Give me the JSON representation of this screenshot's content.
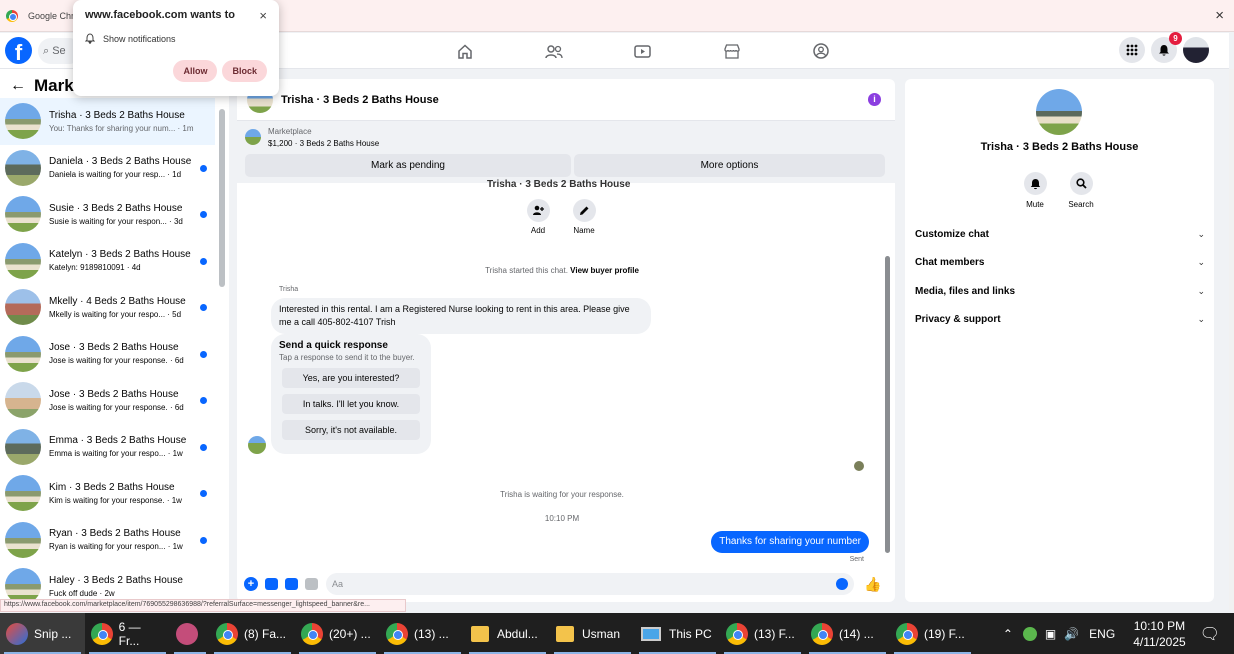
{
  "browser": {
    "app_title": "Google Chr",
    "close_label": "×"
  },
  "notification_prompt": {
    "title": "www.facebook.com wants to",
    "row_label": "Show notifications",
    "allow_label": "Allow",
    "block_label": "Block",
    "close_label": "×"
  },
  "fb_header": {
    "logo_letter": "f",
    "search_placeholder": "Se",
    "notification_count": "9"
  },
  "left_panel": {
    "title": "Marke",
    "conversations": [
      {
        "name": "Trisha · 3 Beds 2 Baths House",
        "preview": "You: Thanks for sharing your num... · 1m",
        "unread": false
      },
      {
        "name": "Daniela · 3 Beds 2 Baths House",
        "preview": "Daniela is waiting for your resp... · 1d",
        "unread": true
      },
      {
        "name": "Susie · 3 Beds 2 Baths House",
        "preview": "Susie is waiting for your respon... · 3d",
        "unread": true
      },
      {
        "name": "Katelyn · 3 Beds 2 Baths House",
        "preview": "Katelyn: 9189810091 · 4d",
        "unread": true
      },
      {
        "name": "Mkelly · 4 Beds 2 Baths House",
        "preview": "Mkelly is waiting for your respo... · 5d",
        "unread": true
      },
      {
        "name": "Jose · 3 Beds 2 Baths House",
        "preview": "Jose is waiting for your response. · 6d",
        "unread": true
      },
      {
        "name": "Jose · 3 Beds 2 Baths House",
        "preview": "Jose is waiting for your response. · 6d",
        "unread": true
      },
      {
        "name": "Emma · 3 Beds 2 Baths House",
        "preview": "Emma is waiting for your respo... · 1w",
        "unread": true
      },
      {
        "name": "Kim · 3 Beds 2 Baths House",
        "preview": "Kim is waiting for your response. · 1w",
        "unread": true
      },
      {
        "name": "Ryan · 3 Beds 2 Baths House",
        "preview": "Ryan is waiting for your respon... · 1w",
        "unread": true
      },
      {
        "name": "Haley · 3 Beds 2 Baths House",
        "preview": "Fuck off dude · 2w",
        "unread": false
      }
    ]
  },
  "chat": {
    "header_title": "Trisha · 3 Beds 2 Baths House",
    "info_label": "i",
    "marketplace_label": "Marketplace",
    "listing_price_title": "$1,200 · 3 Beds 2 Baths House",
    "mark_pending_label": "Mark as pending",
    "more_options_label": "More options",
    "cut_title": "Trisha · 3 Beds 2 Baths House",
    "add_label": "Add",
    "name_label": "Name",
    "started_text": "Trisha started this chat.",
    "view_profile_label": "View buyer profile",
    "sender_name": "Trisha",
    "incoming_message": "Interested in this rental.  I am a Registered Nurse looking to rent in this area.  Please give me a call 405-802-4107 Trish",
    "quick_title": "Send a quick response",
    "quick_subtitle": "Tap a response to send it to the buyer.",
    "quick_responses": [
      "Yes, are you interested?",
      "In talks. I'll let you know.",
      "Sorry, it's not available."
    ],
    "waiting_text": "Trisha is waiting for your response.",
    "time_label": "10:10 PM",
    "outgoing_message": "Thanks for sharing your number",
    "sent_label": "Sent",
    "composer_placeholder": "Aa",
    "like_icon": "👍"
  },
  "right_panel": {
    "title": "Trisha · 3 Beds 2 Baths House",
    "mute_label": "Mute",
    "search_label": "Search",
    "sections": [
      "Customize chat",
      "Chat members",
      "Media, files and links",
      "Privacy & support"
    ]
  },
  "status_url": "https://www.facebook.com/marketplace/item/769055298636988/?referralSurface=messenger_lightspeed_banner&re...",
  "taskbar": {
    "items": [
      {
        "label": "Snip ...",
        "icon": "snip-icon"
      },
      {
        "label": "6 — Fr...",
        "icon": "chrome-icon"
      },
      {
        "label": "",
        "icon": "paint-icon"
      },
      {
        "label": "(8) Fa...",
        "icon": "chrome-icon"
      },
      {
        "label": "(20+) ...",
        "icon": "chrome-icon"
      },
      {
        "label": "(13) ...",
        "icon": "chrome-icon"
      },
      {
        "label": "Abdul...",
        "icon": "folder-icon"
      },
      {
        "label": "Usman",
        "icon": "folder-icon"
      },
      {
        "label": "This PC",
        "icon": "this-pc-icon"
      },
      {
        "label": "(13) F...",
        "icon": "chrome-icon"
      },
      {
        "label": "(14) ...",
        "icon": "chrome-icon"
      },
      {
        "label": "(19) F...",
        "icon": "chrome-icon"
      }
    ],
    "language": "ENG",
    "time": "10:10 PM",
    "date": "4/11/2025"
  }
}
